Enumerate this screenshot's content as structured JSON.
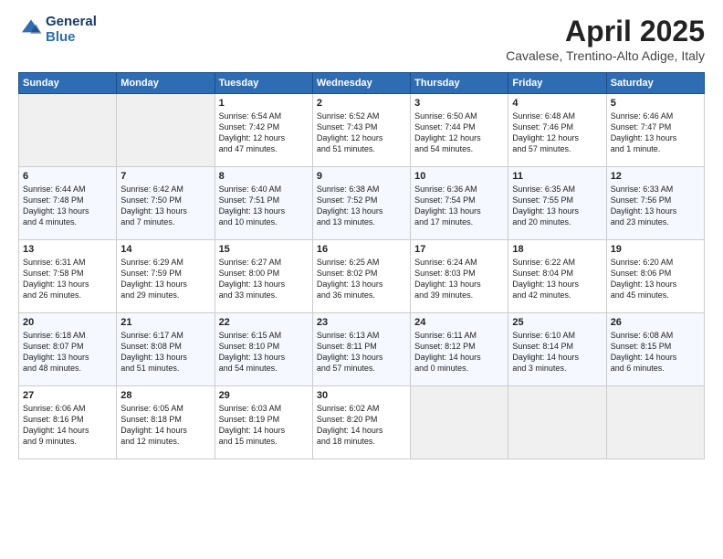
{
  "header": {
    "logo_line1": "General",
    "logo_line2": "Blue",
    "month": "April 2025",
    "location": "Cavalese, Trentino-Alto Adige, Italy"
  },
  "days_of_week": [
    "Sunday",
    "Monday",
    "Tuesday",
    "Wednesday",
    "Thursday",
    "Friday",
    "Saturday"
  ],
  "weeks": [
    [
      {
        "day": "",
        "info": ""
      },
      {
        "day": "",
        "info": ""
      },
      {
        "day": "1",
        "info": "Sunrise: 6:54 AM\nSunset: 7:42 PM\nDaylight: 12 hours\nand 47 minutes."
      },
      {
        "day": "2",
        "info": "Sunrise: 6:52 AM\nSunset: 7:43 PM\nDaylight: 12 hours\nand 51 minutes."
      },
      {
        "day": "3",
        "info": "Sunrise: 6:50 AM\nSunset: 7:44 PM\nDaylight: 12 hours\nand 54 minutes."
      },
      {
        "day": "4",
        "info": "Sunrise: 6:48 AM\nSunset: 7:46 PM\nDaylight: 12 hours\nand 57 minutes."
      },
      {
        "day": "5",
        "info": "Sunrise: 6:46 AM\nSunset: 7:47 PM\nDaylight: 13 hours\nand 1 minute."
      }
    ],
    [
      {
        "day": "6",
        "info": "Sunrise: 6:44 AM\nSunset: 7:48 PM\nDaylight: 13 hours\nand 4 minutes."
      },
      {
        "day": "7",
        "info": "Sunrise: 6:42 AM\nSunset: 7:50 PM\nDaylight: 13 hours\nand 7 minutes."
      },
      {
        "day": "8",
        "info": "Sunrise: 6:40 AM\nSunset: 7:51 PM\nDaylight: 13 hours\nand 10 minutes."
      },
      {
        "day": "9",
        "info": "Sunrise: 6:38 AM\nSunset: 7:52 PM\nDaylight: 13 hours\nand 13 minutes."
      },
      {
        "day": "10",
        "info": "Sunrise: 6:36 AM\nSunset: 7:54 PM\nDaylight: 13 hours\nand 17 minutes."
      },
      {
        "day": "11",
        "info": "Sunrise: 6:35 AM\nSunset: 7:55 PM\nDaylight: 13 hours\nand 20 minutes."
      },
      {
        "day": "12",
        "info": "Sunrise: 6:33 AM\nSunset: 7:56 PM\nDaylight: 13 hours\nand 23 minutes."
      }
    ],
    [
      {
        "day": "13",
        "info": "Sunrise: 6:31 AM\nSunset: 7:58 PM\nDaylight: 13 hours\nand 26 minutes."
      },
      {
        "day": "14",
        "info": "Sunrise: 6:29 AM\nSunset: 7:59 PM\nDaylight: 13 hours\nand 29 minutes."
      },
      {
        "day": "15",
        "info": "Sunrise: 6:27 AM\nSunset: 8:00 PM\nDaylight: 13 hours\nand 33 minutes."
      },
      {
        "day": "16",
        "info": "Sunrise: 6:25 AM\nSunset: 8:02 PM\nDaylight: 13 hours\nand 36 minutes."
      },
      {
        "day": "17",
        "info": "Sunrise: 6:24 AM\nSunset: 8:03 PM\nDaylight: 13 hours\nand 39 minutes."
      },
      {
        "day": "18",
        "info": "Sunrise: 6:22 AM\nSunset: 8:04 PM\nDaylight: 13 hours\nand 42 minutes."
      },
      {
        "day": "19",
        "info": "Sunrise: 6:20 AM\nSunset: 8:06 PM\nDaylight: 13 hours\nand 45 minutes."
      }
    ],
    [
      {
        "day": "20",
        "info": "Sunrise: 6:18 AM\nSunset: 8:07 PM\nDaylight: 13 hours\nand 48 minutes."
      },
      {
        "day": "21",
        "info": "Sunrise: 6:17 AM\nSunset: 8:08 PM\nDaylight: 13 hours\nand 51 minutes."
      },
      {
        "day": "22",
        "info": "Sunrise: 6:15 AM\nSunset: 8:10 PM\nDaylight: 13 hours\nand 54 minutes."
      },
      {
        "day": "23",
        "info": "Sunrise: 6:13 AM\nSunset: 8:11 PM\nDaylight: 13 hours\nand 57 minutes."
      },
      {
        "day": "24",
        "info": "Sunrise: 6:11 AM\nSunset: 8:12 PM\nDaylight: 14 hours\nand 0 minutes."
      },
      {
        "day": "25",
        "info": "Sunrise: 6:10 AM\nSunset: 8:14 PM\nDaylight: 14 hours\nand 3 minutes."
      },
      {
        "day": "26",
        "info": "Sunrise: 6:08 AM\nSunset: 8:15 PM\nDaylight: 14 hours\nand 6 minutes."
      }
    ],
    [
      {
        "day": "27",
        "info": "Sunrise: 6:06 AM\nSunset: 8:16 PM\nDaylight: 14 hours\nand 9 minutes."
      },
      {
        "day": "28",
        "info": "Sunrise: 6:05 AM\nSunset: 8:18 PM\nDaylight: 14 hours\nand 12 minutes."
      },
      {
        "day": "29",
        "info": "Sunrise: 6:03 AM\nSunset: 8:19 PM\nDaylight: 14 hours\nand 15 minutes."
      },
      {
        "day": "30",
        "info": "Sunrise: 6:02 AM\nSunset: 8:20 PM\nDaylight: 14 hours\nand 18 minutes."
      },
      {
        "day": "",
        "info": ""
      },
      {
        "day": "",
        "info": ""
      },
      {
        "day": "",
        "info": ""
      }
    ]
  ]
}
